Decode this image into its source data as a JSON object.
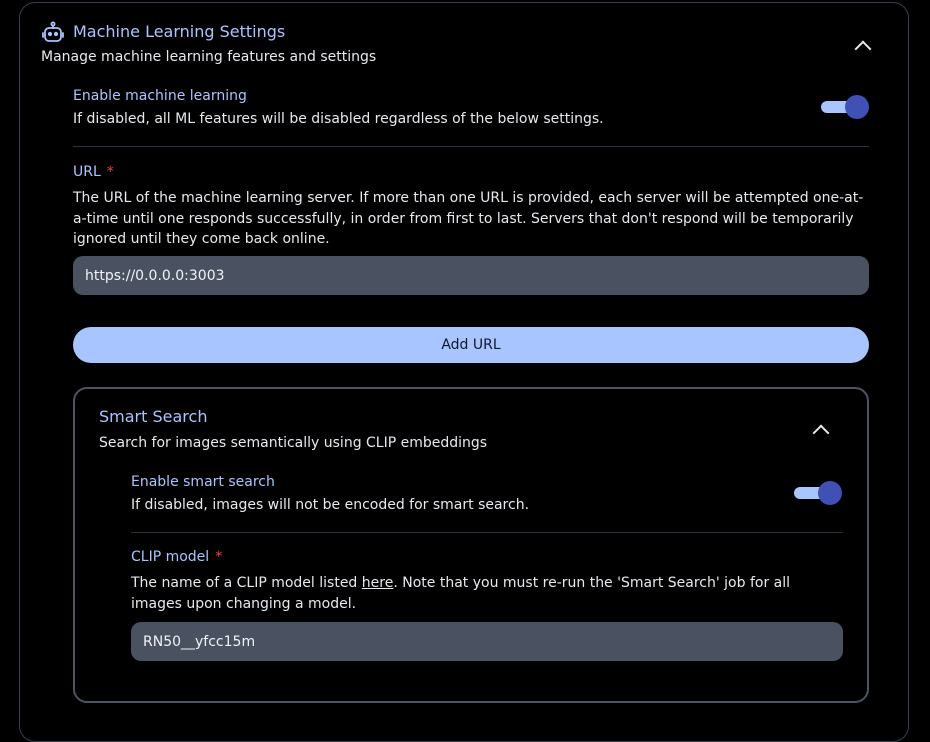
{
  "section": {
    "title": "Machine Learning Settings",
    "description": "Manage machine learning features and settings",
    "icon": "robot-icon"
  },
  "enable_ml": {
    "label": "Enable machine learning",
    "help": "If disabled, all ML features will be disabled regardless of the below settings.",
    "enabled": true
  },
  "url": {
    "label": "URL",
    "required_marker": "*",
    "help": "The URL of the machine learning server. If more than one URL is provided, each server will be attempted one-at-a-time until one responds successfully, in order from first to last. Servers that don't respond will be temporarily ignored until they come back online.",
    "value": "https://0.0.0.0:3003",
    "add_button": "Add URL"
  },
  "smart_search": {
    "title": "Smart Search",
    "description": "Search for images semantically using CLIP embeddings",
    "enable": {
      "label": "Enable smart search",
      "help": "If disabled, images will not be encoded for smart search.",
      "enabled": true
    },
    "clip_model": {
      "label": "CLIP model",
      "required_marker": "*",
      "help_before": "The name of a CLIP model listed ",
      "help_link": "here",
      "help_after": ". Note that you must re-run the 'Smart Search' job for all images upon changing a model.",
      "value": "RN50__yfcc15m"
    }
  },
  "colors": {
    "accent": "#a8c5ff",
    "toggle_knob": "#4050b5",
    "required": "#ef4444",
    "input_bg": "#4a5261",
    "background": "#000000"
  }
}
